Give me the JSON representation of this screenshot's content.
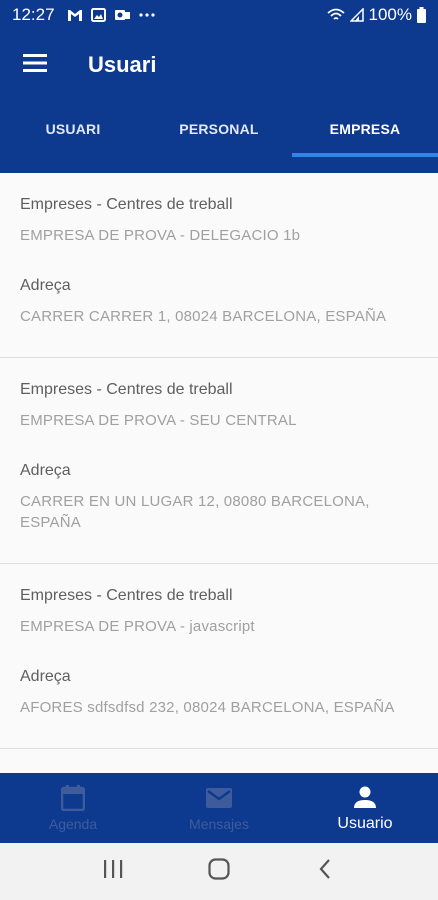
{
  "status_bar": {
    "time": "12:27",
    "battery": "100%",
    "icons": [
      "gmail-icon",
      "image-icon",
      "outlook-icon",
      "more-dots-icon",
      "wifi-icon",
      "signal-icon",
      "battery-icon"
    ]
  },
  "app_bar": {
    "title": "Usuari",
    "menu_icon": "hamburger-icon"
  },
  "tabs": [
    {
      "label": "USUARI",
      "active": false
    },
    {
      "label": "PERSONAL",
      "active": false
    },
    {
      "label": "EMPRESA",
      "active": true
    }
  ],
  "cards": [
    {
      "workplace_label": "Empreses - Centres de treball",
      "workplace_value": "EMPRESA DE PROVA - DELEGACIO 1b",
      "address_label": "Adreça",
      "address_value": "CARRER CARRER 1, 08024 BARCELONA, ESPAÑA"
    },
    {
      "workplace_label": "Empreses - Centres de treball",
      "workplace_value": "EMPRESA DE PROVA - SEU CENTRAL",
      "address_label": "Adreça",
      "address_value": "CARRER EN UN LUGAR 12, 08080 BARCELONA, ESPAÑA"
    },
    {
      "workplace_label": "Empreses - Centres de treball",
      "workplace_value": "EMPRESA DE PROVA - javascript",
      "address_label": "Adreça",
      "address_value": "AFORES sdfsdfsd 232, 08024 BARCELONA, ESPAÑA"
    }
  ],
  "bottom_nav": [
    {
      "label": "Agenda",
      "icon": "calendar-icon",
      "active": false
    },
    {
      "label": "Mensajes",
      "icon": "mail-icon",
      "active": false
    },
    {
      "label": "Usuario",
      "icon": "person-icon",
      "active": true
    }
  ],
  "colors": {
    "primary": "#0d3a8f",
    "tab_indicator": "#2f86e8",
    "label_text": "#5f5f5f",
    "value_text": "#a0a0a0",
    "inactive_nav": "#3e5c9c"
  }
}
